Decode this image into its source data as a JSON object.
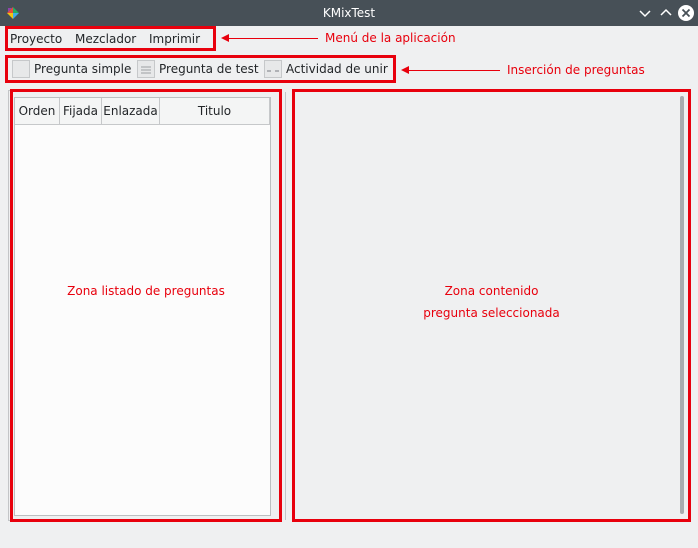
{
  "window": {
    "title": "KMixTest",
    "app_icon": "kmixtest-logo-icon",
    "controls": [
      "minimize-icon",
      "maximize-icon",
      "close-icon"
    ]
  },
  "menubar": {
    "items": [
      {
        "label": "Proyecto"
      },
      {
        "label": "Mezclador"
      },
      {
        "label": "Imprimir"
      }
    ]
  },
  "toolbar": {
    "buttons": [
      {
        "label": "Pregunta simple",
        "icon": "simple-question-icon"
      },
      {
        "label": "Pregunta de test",
        "icon": "test-question-icon"
      },
      {
        "label": "Actividad de unir",
        "icon": "matching-activity-icon"
      }
    ]
  },
  "question_list": {
    "columns": [
      "Orden",
      "Fijada",
      "Enlazada",
      "Titulo"
    ],
    "rows": []
  },
  "annotations": {
    "menu": "Menú de la aplicación",
    "insertion": "Inserción de preguntas",
    "list_zone": "Zona listado de preguntas",
    "content_zone_line1": "Zona contenido",
    "content_zone_line2": "pregunta seleccionada"
  },
  "colors": {
    "titlebar": "#475057",
    "window_bg": "#eff0f1",
    "annotation": "#e8000d"
  }
}
